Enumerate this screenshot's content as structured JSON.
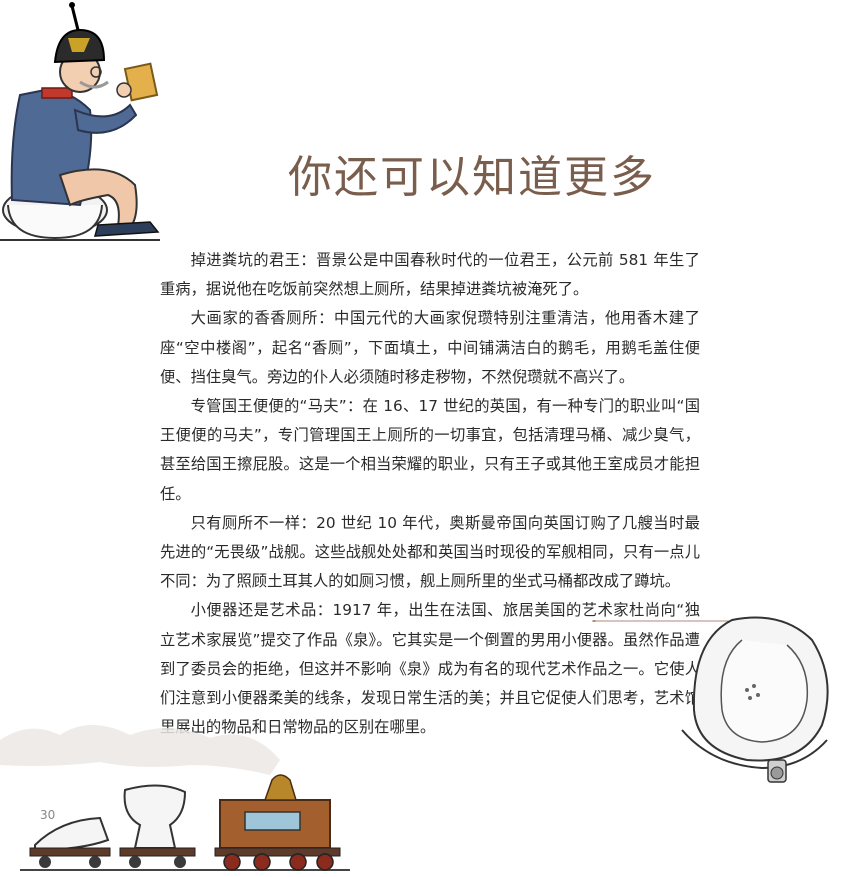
{
  "page": {
    "title": "你还可以知道更多",
    "page_number": "30"
  },
  "paragraphs": [
    {
      "lead": "掉进粪坑的君王：",
      "text": "晋景公是中国春秋时代的一位君王，公元前 581 年生了重病，据说他在吃饭前突然想上厕所，结果掉进粪坑被淹死了。"
    },
    {
      "lead": "大画家的香香厕所：",
      "text": "中国元代的大画家倪瓒特别注重清洁，他用香木建了座“空中楼阁”，起名“香厕”，下面填土，中间铺满洁白的鹅毛，用鹅毛盖住便便、挡住臭气。旁边的仆人必须随时移走秽物，不然倪瓒就不高兴了。"
    },
    {
      "lead": "专管国王便便的“马夫”：",
      "text": "在 16、17 世纪的英国，有一种专门的职业叫“国王便便的马夫”，专门管理国王上厕所的一切事宜，包括清理马桶、减少臭气，甚至给国王擦屁股。这是一个相当荣耀的职业，只有王子或其他王室成员才能担任。"
    },
    {
      "lead": "只有厕所不一样：",
      "text": "20 世纪 10 年代，奥斯曼帝国向英国订购了几艘当时最先进的“无畏级”战舰。这些战舰处处都和英国当时现役的军舰相同，只有一点儿不同：为了照顾土耳其人的如厕习惯，舰上厕所里的坐式马桶都改成了蹲坑。"
    },
    {
      "lead": "小便器还是艺术品：",
      "text": "1917 年，出生在法国、旅居美国的艺术家杜尚向“独立艺术家展览”提交了作品《泉》。它其实是一个倒置的男用小便器。虽然作品遭到了委员会的拒绝，但这并不影响《泉》成为有名的现代艺术作品之一。它使人们注意到小便器柔美的线条，发现日常生活的美；并且它促使人们思考，艺术馆里展出的物品和日常物品的区别在哪里。"
    }
  ],
  "illustrations": {
    "king_icon": "king-on-toilet-illustration",
    "urinal_icon": "fountain-urinal-illustration",
    "train_icon": "toilet-train-illustration"
  },
  "colors": {
    "title": "#7a5e4d",
    "text": "#2a2a2a",
    "urinal_line": "#b08a7a"
  }
}
